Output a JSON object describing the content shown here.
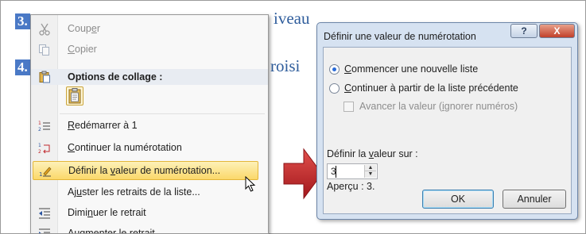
{
  "document": {
    "heading1_num": "3.",
    "heading1_text": "Point de troisième niveau",
    "heading1_visible_fragment": "iveau",
    "heading2_num": "4.",
    "heading2_text": "Point de troisième niveau",
    "heading2_visible_fragment": "roisi"
  },
  "context_menu": {
    "cut": {
      "pre": "Coup",
      "acc": "e",
      "post": "r",
      "icon": "scissors-icon",
      "disabled": true
    },
    "copy": {
      "pre": "",
      "acc": "C",
      "post": "opier",
      "icon": "copy-icon",
      "disabled": true
    },
    "paste_header": "Options de collage :",
    "paste_option_icon": "paste-keep-formatting-icon",
    "items": [
      {
        "pre": "",
        "acc": "R",
        "post": "edémarrer à 1",
        "icon": "restart-numbering-icon"
      },
      {
        "pre": "",
        "acc": "C",
        "post": "ontinuer la numérotation",
        "icon": "continue-numbering-icon"
      },
      {
        "pre": "Définir la ",
        "acc": "v",
        "post": "aleur de numérotation...",
        "icon": "set-numbering-value-icon",
        "highlighted": true
      },
      {
        "pre": "Aj",
        "acc": "u",
        "post": "ster les retraits de la liste...",
        "icon": ""
      },
      {
        "pre": "Dimi",
        "acc": "n",
        "post": "uer le retrait",
        "icon": "decrease-indent-icon"
      },
      {
        "pre": "",
        "acc": "A",
        "post": "ugmenter le retrait",
        "icon": "increase-indent-icon"
      }
    ]
  },
  "dialog": {
    "title": "Définir une valeur de numérotation",
    "help_label": "?",
    "close_label": "X",
    "radio_new": {
      "pre": "",
      "acc": "C",
      "post": "ommencer une nouvelle liste",
      "selected": true
    },
    "radio_continue": {
      "pre": "",
      "acc": "C",
      "post": "ontinuer à partir de la liste précédente",
      "selected": false
    },
    "advance_checkbox": {
      "pre": "Avancer la valeur (",
      "acc": "i",
      "post": "gnorer numéros)",
      "checked": false,
      "disabled": true
    },
    "value_label": {
      "pre": "Définir la ",
      "acc": "v",
      "post": "aleur sur :"
    },
    "value": "3",
    "preview_label": "Aperçu : 3.",
    "ok_label": "OK",
    "cancel_label": "Annuler"
  },
  "colors": {
    "highlight_top": "#fdf1b8",
    "highlight_bottom": "#fbd86a",
    "arrow": "#c0272d",
    "dialog_frame": "#d6e2f1",
    "heading_blue": "#2f5d9c"
  }
}
